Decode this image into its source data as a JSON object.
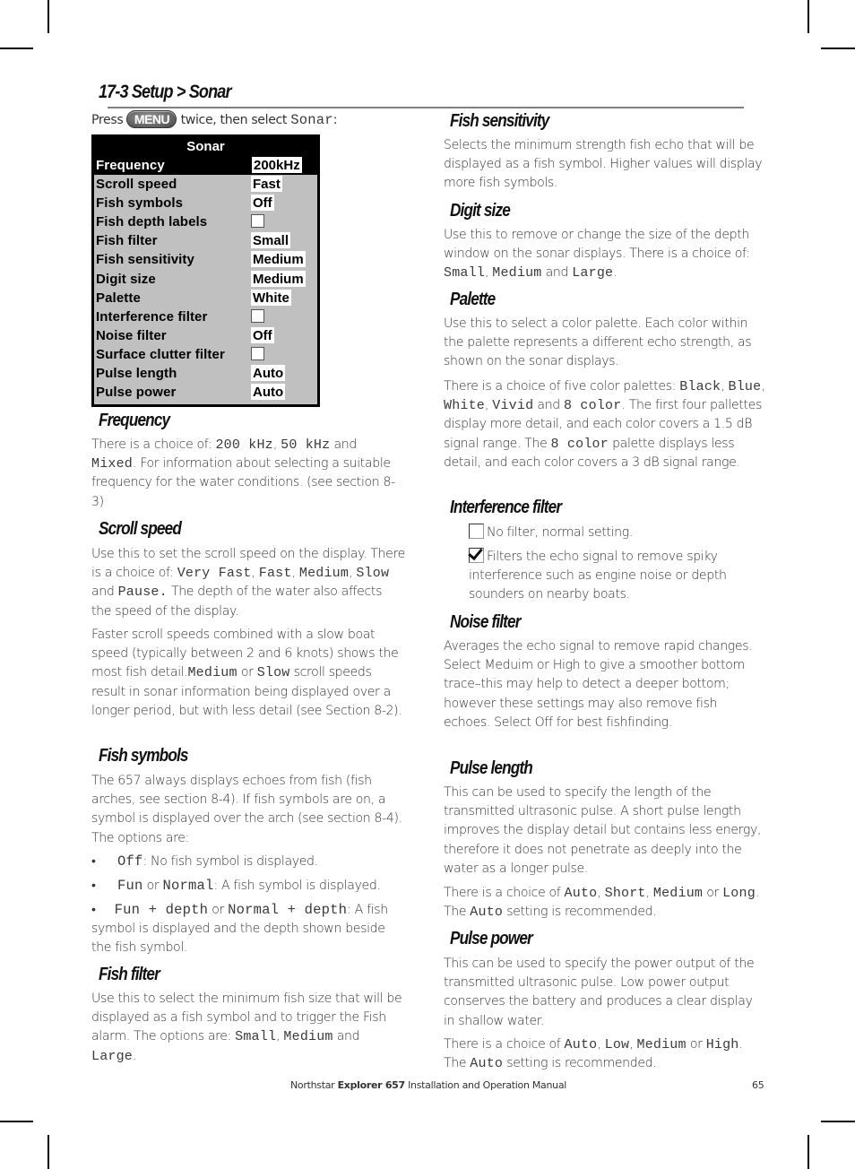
{
  "section": {
    "title": "17-3 Setup > Sonar",
    "press_prefix": "Press",
    "menu_key": "MENU",
    "press_suffix": "twice, then select",
    "press_target": "Sonar",
    "press_end": ":"
  },
  "sonar_menu": {
    "title": "Sonar",
    "rows": [
      {
        "label": "Frequency",
        "value": "200kHz",
        "type": "value",
        "selected": true
      },
      {
        "label": "Scroll speed",
        "value": "Fast",
        "type": "value"
      },
      {
        "label": "Fish symbols",
        "value": "Off",
        "type": "value"
      },
      {
        "label": "Fish depth labels",
        "value": "",
        "type": "checkbox",
        "checked": false
      },
      {
        "label": "Fish filter",
        "value": "Small",
        "type": "value"
      },
      {
        "label": "Fish sensitivity",
        "value": "Medium",
        "type": "value"
      },
      {
        "label": "Digit size",
        "value": "Medium",
        "type": "value"
      },
      {
        "label": "Palette",
        "value": "White",
        "type": "value"
      },
      {
        "label": "Interference filter",
        "value": "",
        "type": "checkbox",
        "checked": false
      },
      {
        "label": "Noise filter",
        "value": "Off",
        "type": "value"
      },
      {
        "label": "Surface clutter filter",
        "value": "",
        "type": "checkbox",
        "checked": false
      },
      {
        "label": "Pulse length",
        "value": "Auto",
        "type": "value"
      },
      {
        "label": "Pulse power",
        "value": "Auto",
        "type": "value"
      }
    ]
  },
  "frequency": {
    "heading": "Frequency",
    "t1": "There is a choice of: ",
    "m1": "200 kHz",
    "t2": ", ",
    "m2": "50 kHz",
    "t3": " and",
    "m3": "Mixed",
    "t4": ". For information about selecting a suitable frequency for the water conditions. (see section 8-3)"
  },
  "scroll_speed": {
    "heading": "Scroll speed",
    "p1_t1": "Use this to set the scroll speed on the display. There is a choice of: ",
    "p1_m1": "Very Fast",
    "p1_t2": ", ",
    "p1_m2": "Fast",
    "p1_t3": ",",
    "p1_m3": "Medium",
    "p1_t4": ", ",
    "p1_m4": "Slow",
    "p1_t5": " and ",
    "p1_m5": "Pause.",
    "p1_t6": " The depth of the water also affects the speed of the display.",
    "p2_t1": "Faster scroll speeds combined with a slow boat speed (typically between 2 and 6 knots) shows the most fish detail.",
    "p2_m1": "Medium",
    "p2_t2": " or ",
    "p2_m2": "Slow",
    "p2_t3": " scroll speeds result in sonar information being displayed over a longer period, but with less detail (see Section 8-2)."
  },
  "fish_symbols": {
    "heading": "Fish symbols",
    "intro": "The 657 always displays echoes from fish (fish arches, see section 8-4). If fish symbols are on, a symbol is displayed over the arch (see section 8-4). The options are:",
    "bullets": [
      {
        "m1": "Off",
        "t1": ": No fish symbol is displayed."
      },
      {
        "m1": "Fun",
        "t1": " or ",
        "m2": "Normal",
        "t2": ": A fish symbol is displayed."
      },
      {
        "m1": "Fun + depth",
        "t1": " or ",
        "m2": "Normal + depth",
        "t2": ": A fish symbol is displayed and the depth shown beside the fish symbol."
      }
    ]
  },
  "fish_filter": {
    "heading": "Fish filter",
    "t1": "Use this to select the minimum fish size that will be displayed as a fish symbol and to trigger the Fish alarm. The options are:  ",
    "m1": "Small",
    "t2": ", ",
    "m2": "Medium",
    "t3": " and ",
    "m3": "Large",
    "t4": "."
  },
  "fish_sensitivity": {
    "heading": "Fish sensitivity",
    "text": "Selects the minimum strength fish echo that will be displayed as a fish symbol. Higher values will display more fish symbols."
  },
  "digit_size": {
    "heading": "Digit size",
    "t1": "Use this to remove or change the size of the depth window on the sonar displays. There is a choice of: ",
    "m1": "Small",
    "t2": ", ",
    "m2": "Medium",
    "t3": " and ",
    "m3": "Large",
    "t4": "."
  },
  "palette": {
    "heading": "Palette",
    "p1": "Use this to select a color palette. Each color within the palette represents a different echo strength, as shown on the sonar displays.",
    "p2_t1": "There is a choice of five color palettes: ",
    "p2_m1": "Black",
    "p2_t2": ", ",
    "p2_m2": "Blue",
    "p2_t3": ", ",
    "p2_m3": "White",
    "p2_t4": ", ",
    "p2_m4": "Vivid",
    "p2_t5": " and ",
    "p2_m5": "8 color",
    "p2_t6": ". The first four pallettes display more detail, and each color covers a 1.5 dB signal range. The ",
    "p2_m6": "8 color",
    "p2_t7": " palette displays less detail, and each color covers a 3 dB signal range."
  },
  "interference_filter": {
    "heading": "Interference filter",
    "off_text": "No filter, normal setting.",
    "on_text": "Filters the echo signal to remove spiky interference such as engine noise or depth sounders on nearby boats."
  },
  "noise_filter": {
    "heading": "Noise filter",
    "text": "Averages the echo signal to remove rapid changes. Select Meduim or High to give a smoother bottom trace–this may help to detect a deeper bottom; however these settings may also remove fish echoes. Select Off for best fishfinding."
  },
  "pulse_length": {
    "heading": "Pulse length",
    "p1": "This can be used to specify the length of the transmitted ultrasonic pulse.  A short pulse length improves the display detail but contains less energy, therefore it does not penetrate as deeply into the water as a longer pulse.",
    "p2_t1": "There is a choice of ",
    "p2_m1": "Auto",
    "p2_t2": ", ",
    "p2_m2": "Short",
    "p2_t3": ", ",
    "p2_m3": "Medium",
    "p2_t4": " or ",
    "p2_m4": "Long",
    "p2_t5": ". The ",
    "p2_m5": "Auto",
    "p2_t6": "  setting is recommended."
  },
  "pulse_power": {
    "heading": "Pulse power",
    "p1": "This can be used to specify the power output of the transmitted ultrasonic pulse. Low power output conserves the battery and produces a clear display in shallow water.",
    "p2_t1": "There is a choice of ",
    "p2_m1": "Auto",
    "p2_t2": ", ",
    "p2_m2": "Low",
    "p2_t3": ", ",
    "p2_m3": "Medium",
    "p2_t4": " or ",
    "p2_m4": "High",
    "p2_t5": ". The ",
    "p2_m5": "Auto",
    "p2_t6": " setting is recommended."
  },
  "footer": {
    "brand": "Northstar ",
    "product": "Explorer 657",
    "suffix": " Installation and Operation Manual",
    "page_number": "65"
  }
}
